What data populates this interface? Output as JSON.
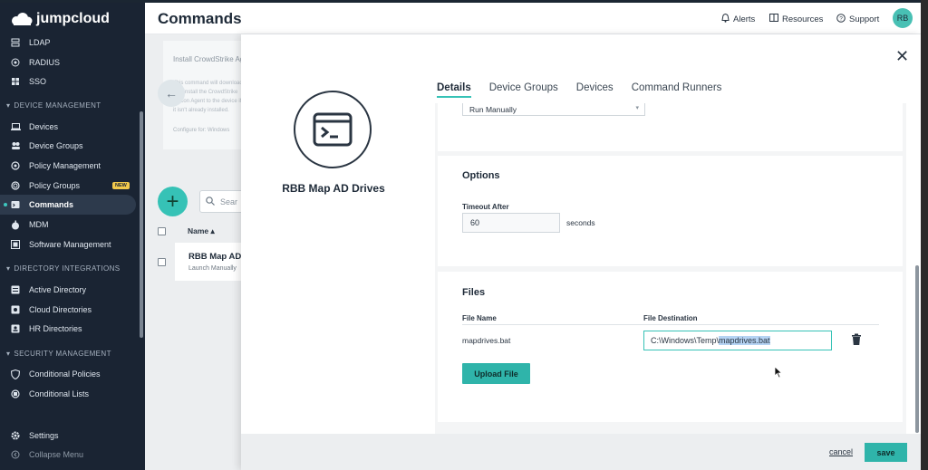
{
  "app": {
    "brand": "jumpcloud",
    "page_title": "Commands"
  },
  "header": {
    "alerts": "Alerts",
    "resources": "Resources",
    "support": "Support",
    "avatar_initials": "RB"
  },
  "sidebar": {
    "top_items": [
      {
        "label": "LDAP",
        "icon": "ldap-icon"
      },
      {
        "label": "RADIUS",
        "icon": "radius-icon"
      },
      {
        "label": "SSO",
        "icon": "sso-icon"
      }
    ],
    "sections": [
      {
        "title": "DEVICE MANAGEMENT",
        "items": [
          {
            "label": "Devices"
          },
          {
            "label": "Device Groups"
          },
          {
            "label": "Policy Management"
          },
          {
            "label": "Policy Groups",
            "badge": "NEW"
          },
          {
            "label": "Commands",
            "active": true
          },
          {
            "label": "MDM"
          },
          {
            "label": "Software Management"
          }
        ]
      },
      {
        "title": "DIRECTORY INTEGRATIONS",
        "items": [
          {
            "label": "Active Directory"
          },
          {
            "label": "Cloud Directories"
          },
          {
            "label": "HR Directories"
          }
        ]
      },
      {
        "title": "SECURITY MANAGEMENT",
        "items": [
          {
            "label": "Conditional Policies"
          },
          {
            "label": "Conditional Lists"
          }
        ]
      }
    ],
    "bottom_items": [
      {
        "label": "Settings"
      },
      {
        "label": "Collapse Menu"
      }
    ]
  },
  "background": {
    "card_title": "Install CrowdStrike Agent",
    "card_desc": "This command will download and install the CrowdStrike Falcon Agent to the device if it isn't already installed.",
    "card_configure": "Configure for:  Windows",
    "search_placeholder": "Sear",
    "column_name": "Name ▴",
    "row_name": "RBB Map AD",
    "row_sub": "Launch Manually"
  },
  "modal": {
    "command_name": "RBB Map AD Drives",
    "tabs": [
      "Details",
      "Device Groups",
      "Devices",
      "Command Runners"
    ],
    "launch_select": "Run Manually",
    "options": {
      "title": "Options",
      "timeout_label": "Timeout After",
      "timeout_value": "60",
      "timeout_unit": "seconds"
    },
    "files": {
      "title": "Files",
      "col_file_name": "File Name",
      "col_file_destination": "File Destination",
      "file_name": "mapdrives.bat",
      "destination_prefix": "C:\\Windows\\Temp\\",
      "destination_selected": "mapdrives.bat",
      "upload_label": "Upload File"
    },
    "cancel_label": "cancel",
    "save_label": "save"
  },
  "colors": {
    "accent": "#36c2b6",
    "sidebar_bg": "#1a2433",
    "button": "#2fb4aa"
  }
}
